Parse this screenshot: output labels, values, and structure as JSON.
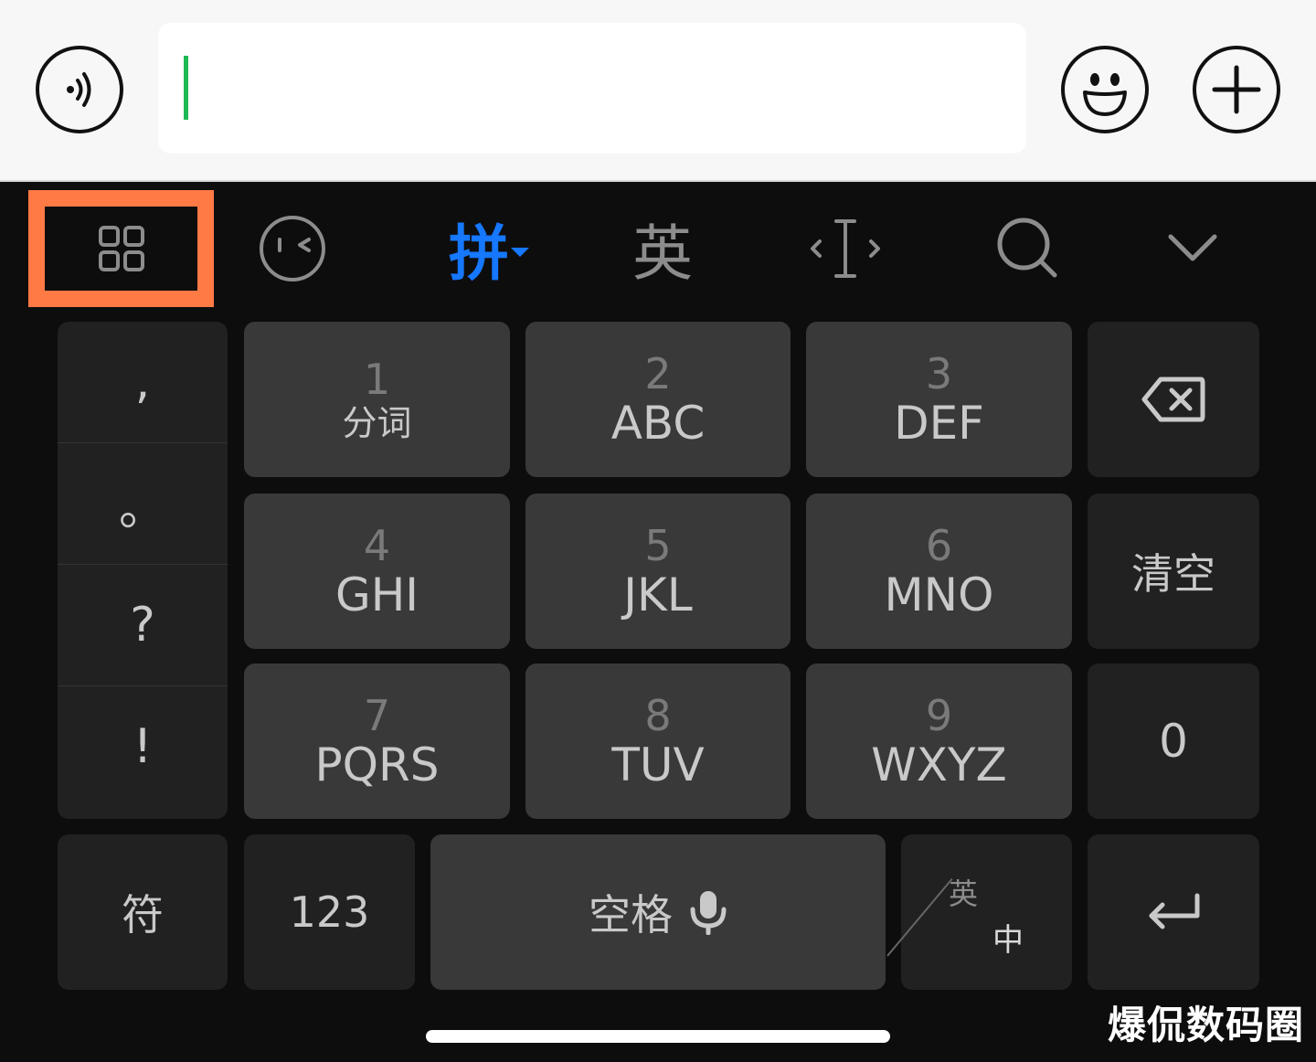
{
  "input_bar": {
    "voice_icon": "voice-wave-icon",
    "emoji_icon": "smile-icon",
    "plus_icon": "plus-icon",
    "input_value": ""
  },
  "toolbar": {
    "menu_icon": "grid-icon",
    "face_icon": "wink-face-icon",
    "pinyin_label": "拼",
    "english_label": "英",
    "cursor_icon": "text-cursor-icon",
    "search_icon": "search-icon",
    "collapse_icon": "chevron-down-icon",
    "highlight_color": "#ff7a45",
    "active_color": "#1677ff"
  },
  "punctuation": [
    ",",
    "。",
    "?",
    "!"
  ],
  "keys": [
    {
      "num": "1",
      "letters": "分词"
    },
    {
      "num": "2",
      "letters": "ABC"
    },
    {
      "num": "3",
      "letters": "DEF"
    },
    {
      "num": "4",
      "letters": "GHI"
    },
    {
      "num": "5",
      "letters": "JKL"
    },
    {
      "num": "6",
      "letters": "MNO"
    },
    {
      "num": "7",
      "letters": "PQRS"
    },
    {
      "num": "8",
      "letters": "TUV"
    },
    {
      "num": "9",
      "letters": "WXYZ"
    }
  ],
  "right_col": {
    "backspace_icon": "backspace-icon",
    "clear_label": "清空",
    "zero_label": "0"
  },
  "bottom_row": {
    "symbols_label": "符",
    "numbers_label": "123",
    "space_label": "空格",
    "mic_icon": "microphone-icon",
    "switch_top": "英",
    "switch_bottom": "中",
    "enter_icon": "return-icon"
  },
  "watermark": "爆侃数码圈"
}
